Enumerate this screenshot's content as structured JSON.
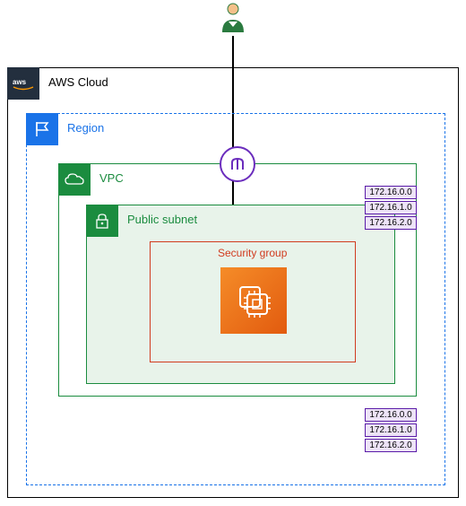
{
  "labels": {
    "aws_cloud": "AWS Cloud",
    "region": "Region",
    "vpc": "VPC",
    "subnet": "Public subnet",
    "security_group": "Security group"
  },
  "cidr_blocks_top": [
    "172.16.0.0",
    "172.16.1.0",
    "172.16.2.0"
  ],
  "cidr_blocks_bottom": [
    "172.16.0.0",
    "172.16.1.0",
    "172.16.2.0"
  ],
  "icons": {
    "user": "user-icon",
    "aws": "aws-logo",
    "region_flag": "flag-icon",
    "vpc_cloud": "cloud-icon",
    "gateway": "internet-gateway-icon",
    "subnet_lock": "lock-icon",
    "ec2": "ec2-instance-icon"
  }
}
